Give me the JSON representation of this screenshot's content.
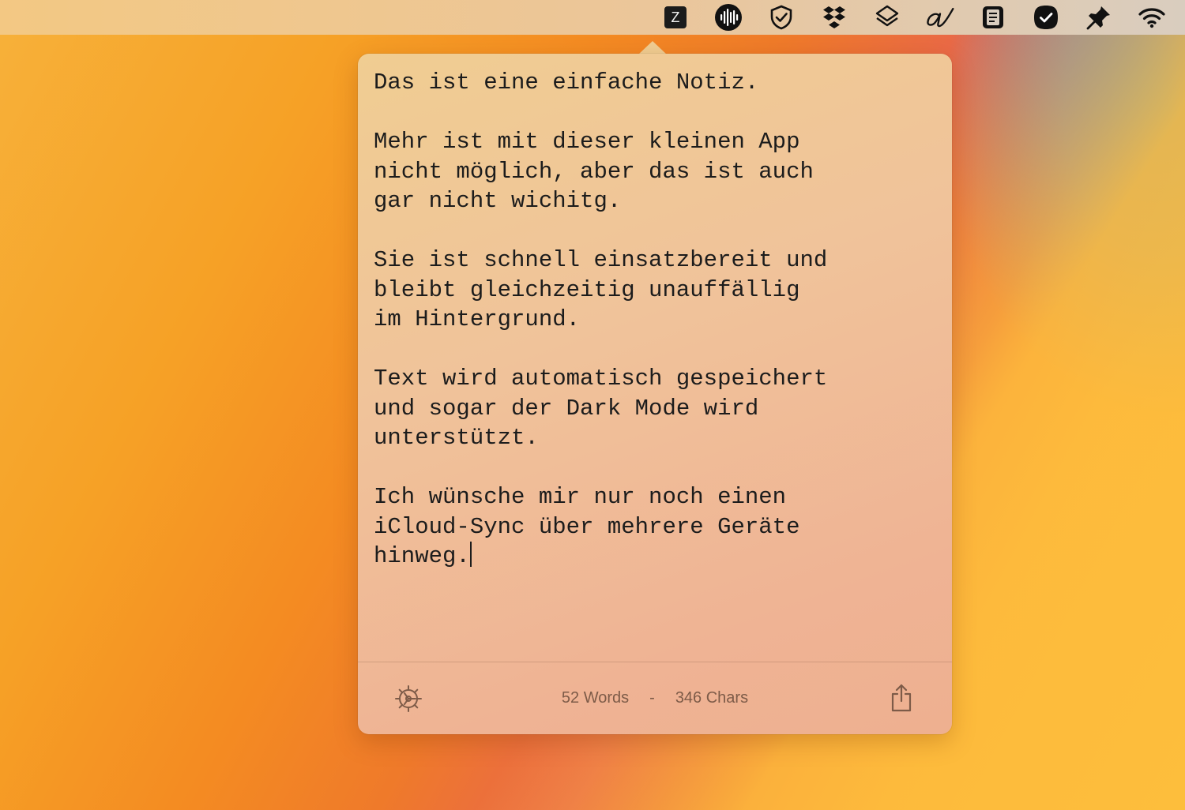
{
  "menubar": {
    "icons": [
      {
        "name": "z-app-icon",
        "glyph": "Z"
      },
      {
        "name": "audio-waveform-icon"
      },
      {
        "name": "shield-check-icon"
      },
      {
        "name": "dropbox-icon"
      },
      {
        "name": "layers-icon"
      },
      {
        "name": "handwriting-a-icon"
      },
      {
        "name": "clipboard-icon"
      },
      {
        "name": "checkmark-circle-icon"
      },
      {
        "name": "pin-icon"
      },
      {
        "name": "wifi-icon"
      }
    ]
  },
  "note": {
    "text": "Das ist eine einfache Notiz.\n\nMehr ist mit dieser kleinen App\nnicht möglich, aber das ist auch\ngar nicht wichitg.\n\nSie ist schnell einsatzbereit und\nbleibt gleichzeitig unauffällig\nim Hintergrund.\n\nText wird automatisch gespeichert\nund sogar der Dark Mode wird\nunterstützt.\n\nIch wünsche mir nur noch einen\niCloud-Sync über mehrere Geräte\nhinweg."
  },
  "footer": {
    "words": "52 Words",
    "separator": "-",
    "chars": "346 Chars"
  },
  "colors": {
    "popover_bg": "#f0c39a",
    "text": "#1c1c1c",
    "footer_text": "#7d5b48"
  }
}
